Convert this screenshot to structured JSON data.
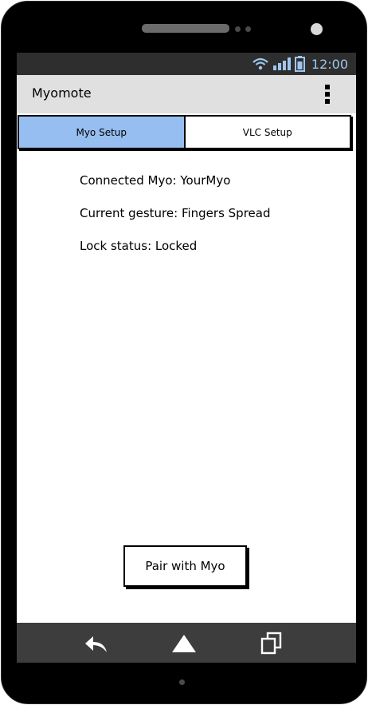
{
  "device": {
    "status_bar": {
      "time": "12:00",
      "icons": [
        "wifi-icon",
        "signal-icon",
        "battery-icon"
      ],
      "icon_color": "#9fc6ee"
    },
    "nav_bar": {
      "icons": [
        "back-icon",
        "home-icon",
        "recent-apps-icon"
      ]
    }
  },
  "app_bar": {
    "title": "Myomote",
    "menu_icon": "overflow-menu-icon"
  },
  "tabs": [
    {
      "label": "Myo Setup",
      "active": true
    },
    {
      "label": "VLC Setup",
      "active": false
    }
  ],
  "info": {
    "connected_myo": "Connected Myo: YourMyo",
    "current_gesture": "Current gesture: Fingers Spread",
    "lock_status": "Lock status: Locked"
  },
  "actions": {
    "pair_label": "Pair with Myo"
  },
  "colors": {
    "active_tab": "#97bef0",
    "app_bar": "#e0e0e0",
    "status_bar": "#2e2e2e",
    "nav_bar": "#3d3d3d"
  }
}
